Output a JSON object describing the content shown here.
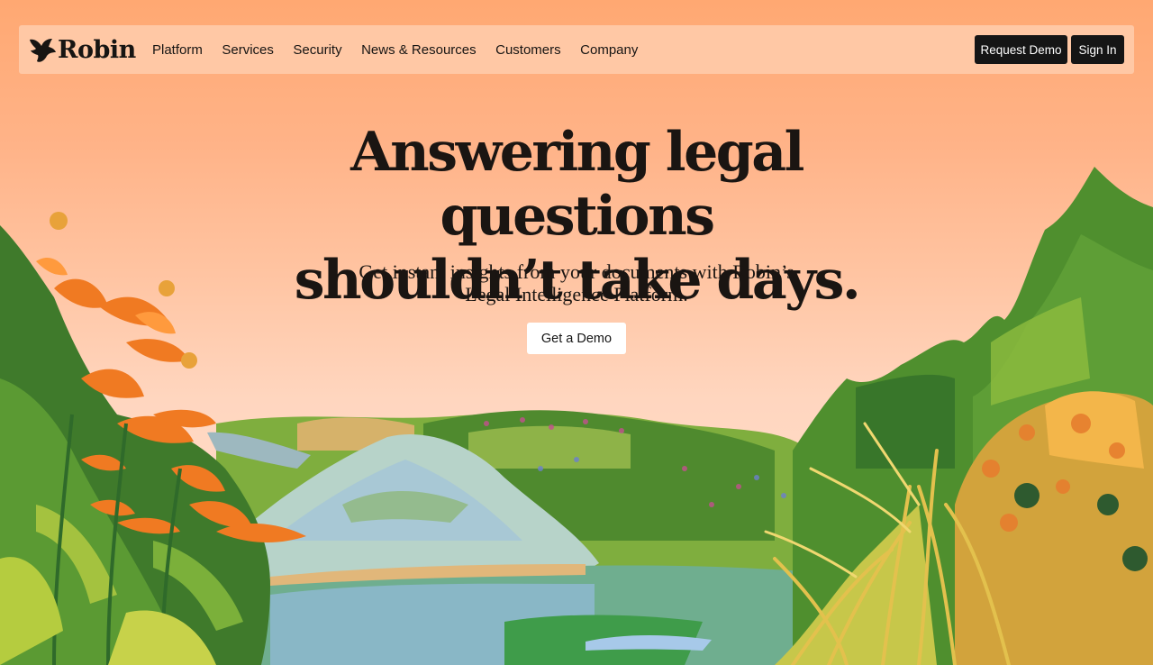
{
  "brand": {
    "name": "Robin",
    "logo_icon": "bird-icon"
  },
  "nav": {
    "links": [
      "Platform",
      "Services",
      "Security",
      "News & Resources",
      "Customers",
      "Company"
    ],
    "request_demo": "Request Demo",
    "sign_in": "Sign In"
  },
  "hero": {
    "title_line1": "Answering legal questions",
    "title_line2": "shouldn’t take days.",
    "subtitle_line1": "Get instant insights from your documents with Robin’s",
    "subtitle_line2": "Legal Intelligence Platform.",
    "cta": "Get a Demo"
  },
  "colors": {
    "sky_top": "#ffa872",
    "sky_bottom": "#ffd9c4",
    "nav_bg": "#ffc8a5",
    "button_dark": "#151515",
    "text_dark": "#1a1512"
  }
}
